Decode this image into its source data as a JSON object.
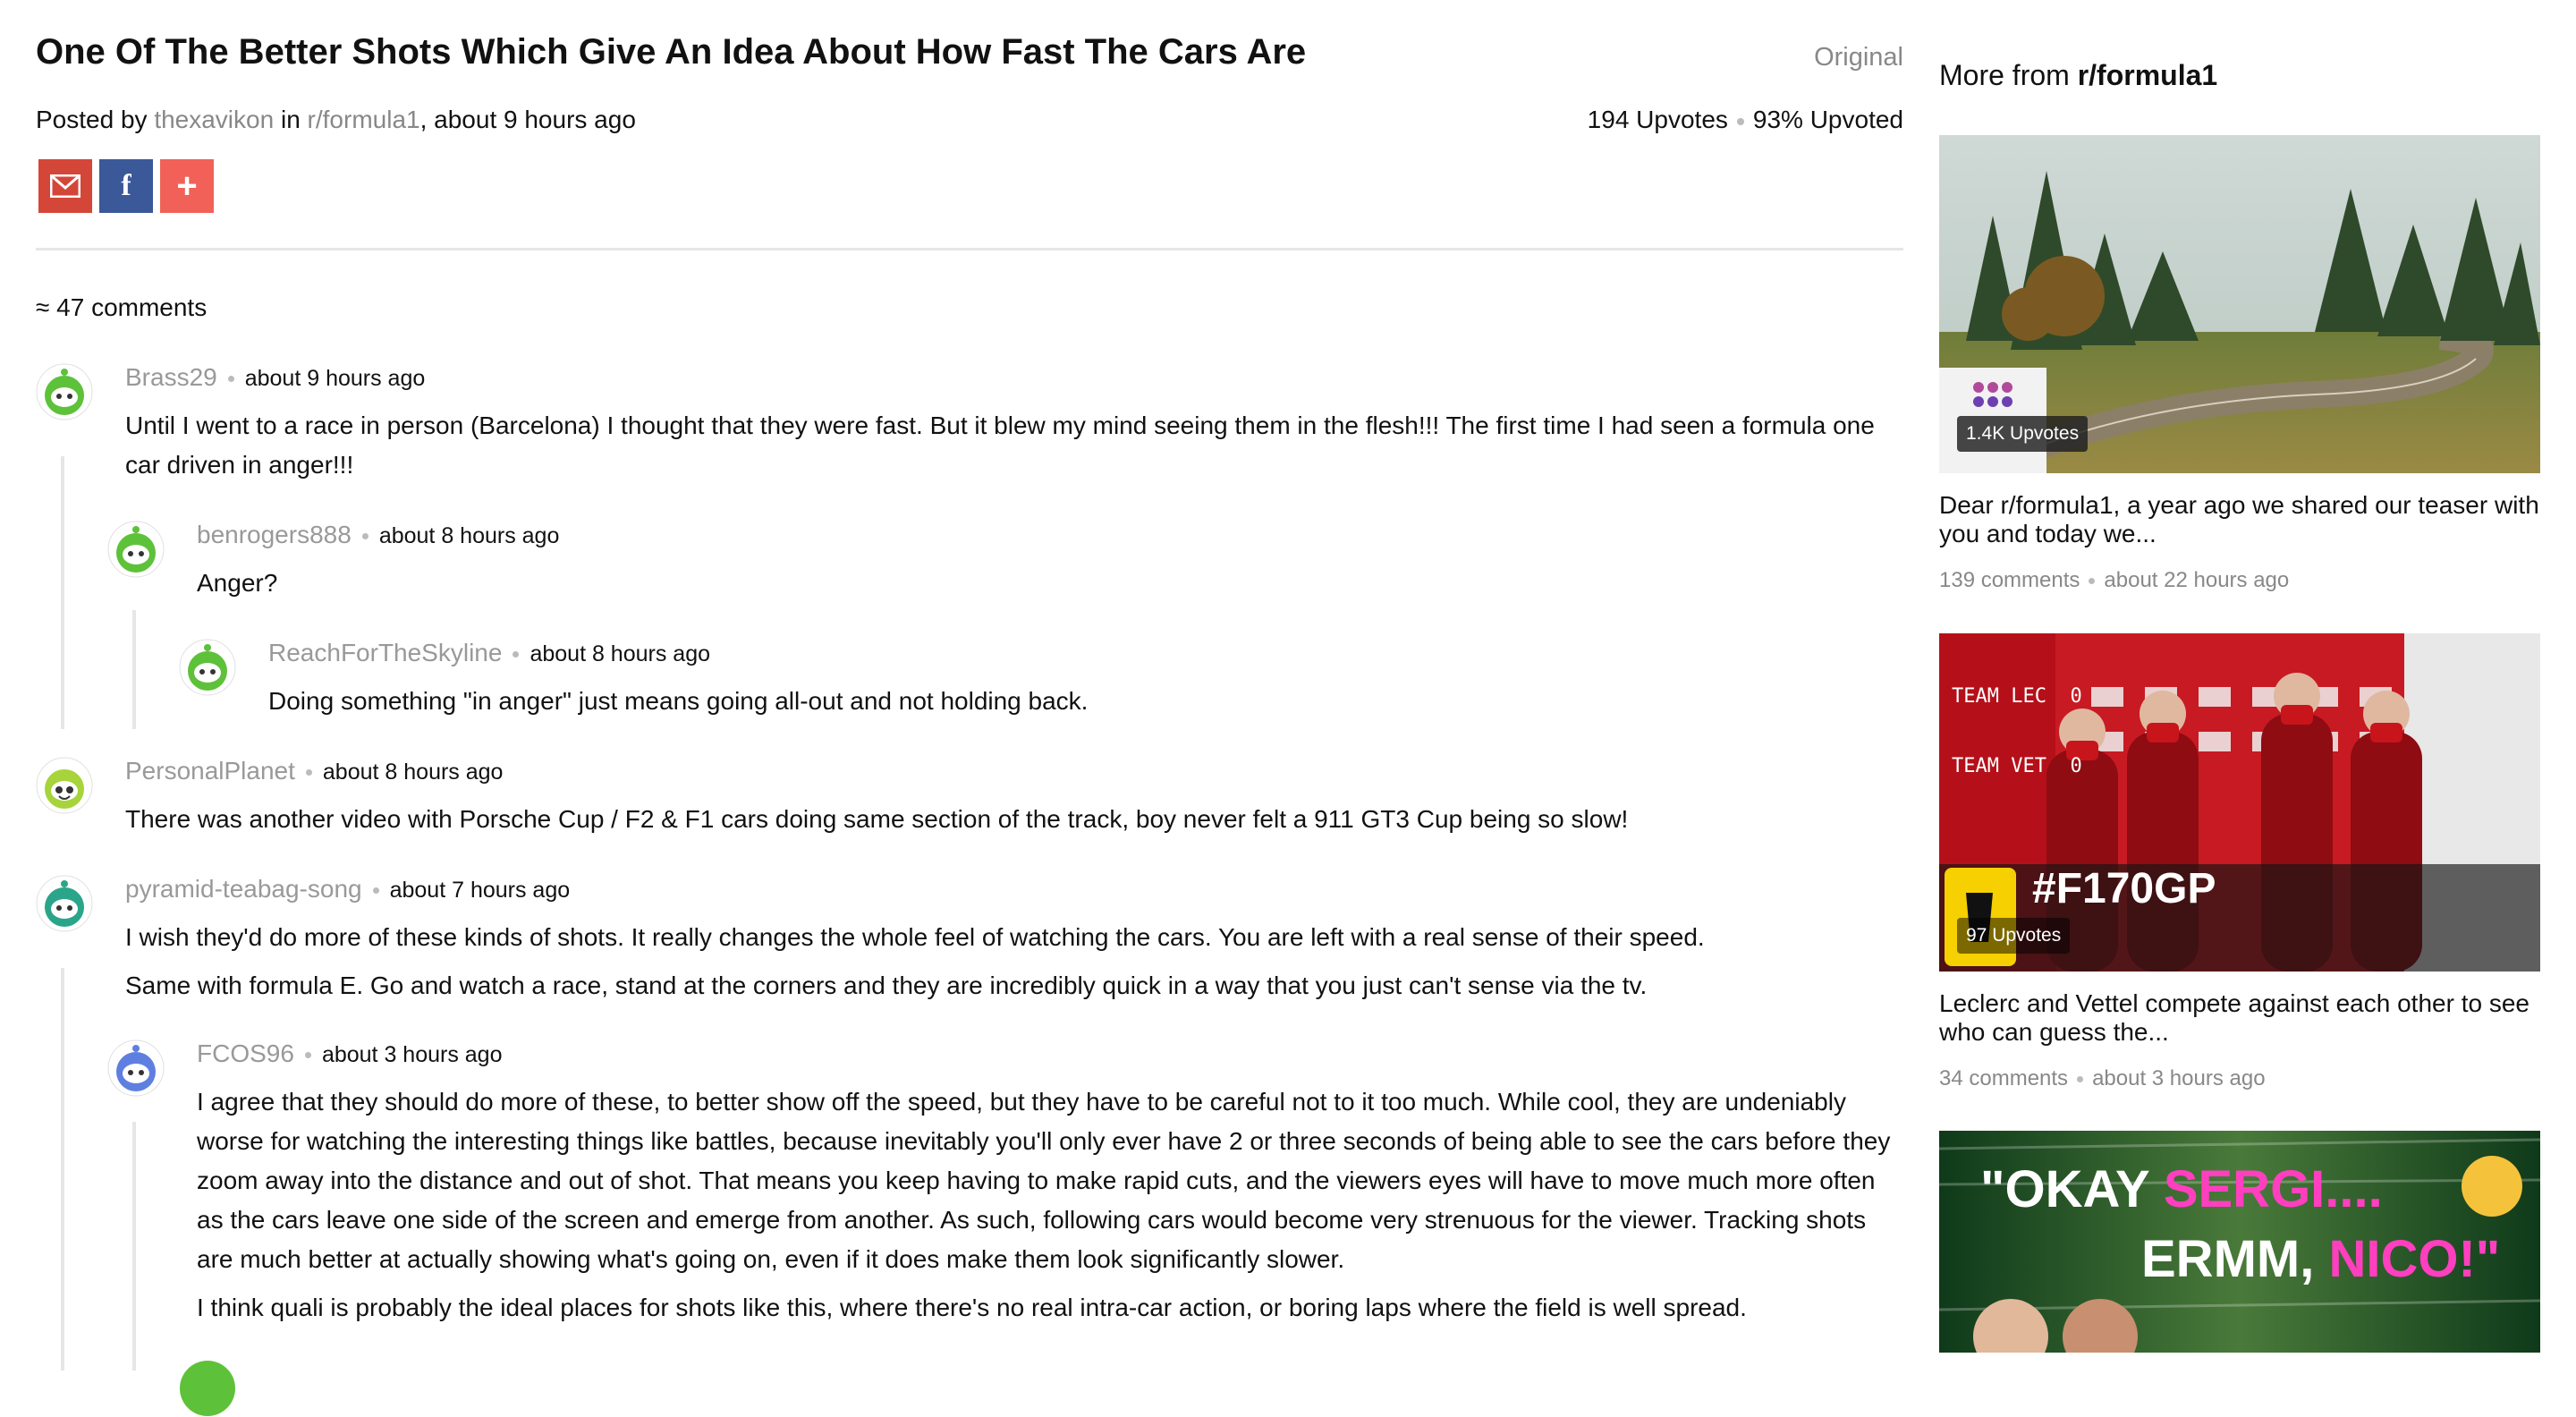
{
  "post": {
    "title": "One Of The Better Shots Which Give An Idea About How Fast The Cars Are",
    "original_label": "Original",
    "posted_by_prefix": "Posted by",
    "author": "thexavikon",
    "in_label": "in",
    "subreddit": "r/formula1",
    "time": ", about 9 hours ago",
    "upvotes": "194 Upvotes",
    "upvoted_pct": "93% Upvoted",
    "share": {
      "gmail_icon": "gmail-icon",
      "facebook_icon": "facebook-icon",
      "more_icon": "plus-icon"
    }
  },
  "comments_header": "≈ 47 comments",
  "comments": [
    {
      "user": "Brass29",
      "time": "about 9 hours ago",
      "avatar_color": "#5ec13a",
      "paragraphs": [
        "Until I went to a race in person (Barcelona) I thought that they were fast. But it blew my mind seeing them in the flesh!!! The first time I had seen a formula one car driven in anger!!!"
      ]
    },
    {
      "user": "benrogers888",
      "time": "about 8 hours ago",
      "avatar_color": "#5ec13a",
      "paragraphs": [
        "Anger?"
      ]
    },
    {
      "user": "ReachForTheSkyline",
      "time": "about 8 hours ago",
      "avatar_color": "#5ec13a",
      "paragraphs": [
        "Doing something \"in anger\" just means going all-out and not holding back."
      ]
    },
    {
      "user": "PersonalPlanet",
      "time": "about 8 hours ago",
      "avatar_color": "#a6d43a",
      "paragraphs": [
        "There was another video with Porsche Cup / F2 & F1 cars doing same section of the track, boy never felt a 911 GT3 Cup being so slow!"
      ]
    },
    {
      "user": "pyramid-teabag-song",
      "time": "about 7 hours ago",
      "avatar_color": "#2ba58a",
      "paragraphs": [
        "I wish they'd do more of these kinds of shots. It really changes the whole feel of watching the cars. You are left with a real sense of their speed.",
        "Same with formula E. Go and watch a race, stand at the corners and they are incredibly quick in a way that you just can't sense via the tv."
      ]
    },
    {
      "user": "FCOS96",
      "time": "about 3 hours ago",
      "avatar_color": "#5f7fe0",
      "paragraphs": [
        "I agree that they should do more of these, to better show off the speed, but they have to be careful not to it too much. While cool, they are undeniably worse for watching the interesting things like battles, because inevitably you'll only ever have 2 or three seconds of being able to see the cars before they zoom away into the distance and out of shot. That means you keep having to make rapid cuts, and the viewers eyes will have to move much more often as the cars leave one side of the screen and emerge from another. As such, following cars would become very strenuous for the viewer. Tracking shots are much better at actually showing what's going on, even if it does make them look significantly slower.",
        "I think quali is probably the ideal places for shots like this, where there's no real intra-car action, or boring laps where the field is well spread."
      ]
    }
  ],
  "sidebar": {
    "heading_prefix": "More from",
    "heading_sub": "r/formula1",
    "cards": [
      {
        "badge": "1.4K Upvotes",
        "title": "Dear r/formula1, a year ago we shared our teaser with you and today we...",
        "comments": "139 comments",
        "time": "about 22 hours ago"
      },
      {
        "badge": "97 Upvotes",
        "title": "Leclerc and Vettel compete against each other to see who can guess the...",
        "comments": "34 comments",
        "time": "about 3 hours ago",
        "overlay_text": "#F170GP",
        "score_lines": [
          "TEAM LEC  0",
          "TEAM VET  0"
        ]
      },
      {
        "banner_line1_a": "\"OKAY ",
        "banner_line1_b": "SERGI....",
        "banner_line2_a": "ERMM, ",
        "banner_line2_b": "NICO!\""
      }
    ]
  },
  "colors": {
    "muted": "#888888",
    "gmail": "#d44638",
    "facebook": "#3b5998",
    "share_more": "#f16157",
    "ferrari_red": "#d4141c",
    "banner_pink": "#ff3fbf"
  }
}
